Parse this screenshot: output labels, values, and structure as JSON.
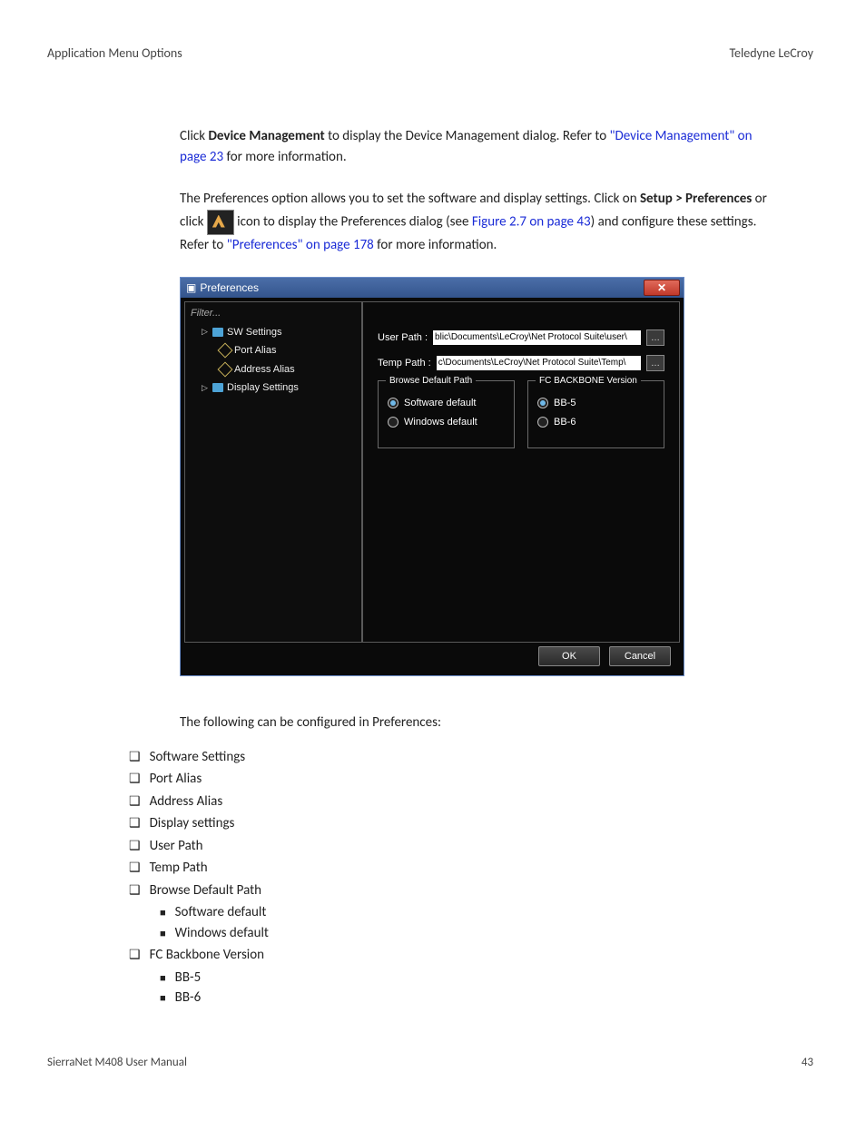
{
  "header": {
    "left": "Application Menu Options",
    "right": "Teledyne LeCroy"
  },
  "para1": {
    "pre": "Click ",
    "bold": "Device Management",
    "mid": " to display the Device Management dialog. Refer to ",
    "link": "\"Device Management\" on page 23",
    "post": " for more information."
  },
  "para2": {
    "pre": "The Preferences option allows you to set the software and display settings. Click on ",
    "bold1": "Setup > Preferences",
    "mid1": " or click ",
    "mid2": " icon to display the Preferences dialog (see ",
    "link1": "Figure 2.7 on page 43",
    "mid3": ") and configure these settings. Refer to ",
    "link2": "\"Preferences\" on page 178",
    "post": " for more information."
  },
  "dialog": {
    "title": "Preferences",
    "tree": {
      "filter": "Filter...",
      "sw": "SW Settings",
      "port": "Port Alias",
      "addr": "Address Alias",
      "disp": "Display Settings"
    },
    "paths": {
      "user_label": "User Path :",
      "user_value": "blic\\Documents\\LeCroy\\Net Protocol Suite\\user\\",
      "temp_label": "Temp Path :",
      "temp_value": "c\\Documents\\LeCroy\\Net Protocol Suite\\Temp\\"
    },
    "group1": {
      "title": "Browse Default Path",
      "opt1": "Software default",
      "opt2": "Windows default"
    },
    "group2": {
      "title": "FC BACKBONE Version",
      "opt1": "BB-5",
      "opt2": "BB-6"
    },
    "buttons": {
      "ok": "OK",
      "cancel": "Cancel"
    }
  },
  "followup": "The following can be configured in Preferences:",
  "list": {
    "i1": "Software Settings",
    "i2": "Port Alias",
    "i3": "Address Alias",
    "i4": "Display settings",
    "i5": "User Path",
    "i6": "Temp Path",
    "i7": "Browse Default Path",
    "i7a": "Software default",
    "i7b": "Windows default",
    "i8": "FC Backbone Version",
    "i8a": "BB-5",
    "i8b": "BB-6"
  },
  "footer": {
    "left": "SierraNet M408 User Manual",
    "right": "43"
  }
}
